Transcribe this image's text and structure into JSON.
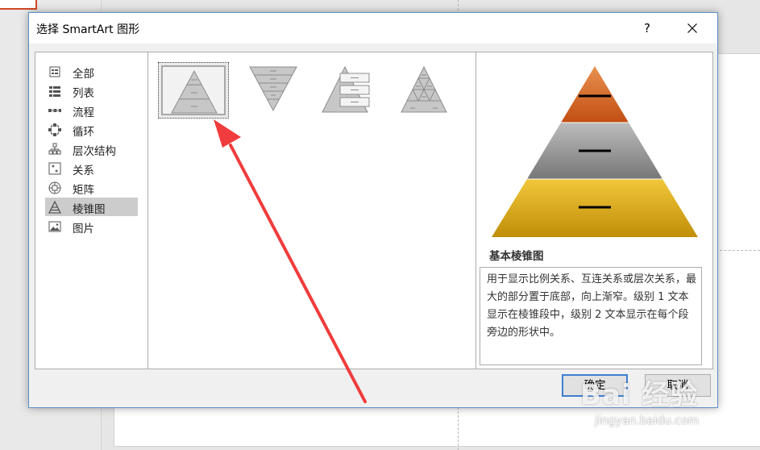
{
  "dialog": {
    "title": "选择 SmartArt 图形",
    "help_label": "?",
    "ok_label": "确定",
    "cancel_label": "取消"
  },
  "categories": [
    {
      "label": "全部",
      "icon": "all-icon"
    },
    {
      "label": "列表",
      "icon": "list-icon"
    },
    {
      "label": "流程",
      "icon": "process-icon"
    },
    {
      "label": "循环",
      "icon": "cycle-icon"
    },
    {
      "label": "层次结构",
      "icon": "hierarchy-icon"
    },
    {
      "label": "关系",
      "icon": "relationship-icon"
    },
    {
      "label": "矩阵",
      "icon": "matrix-icon"
    },
    {
      "label": "棱锥图",
      "icon": "pyramid-icon",
      "selected": true
    },
    {
      "label": "图片",
      "icon": "picture-icon"
    }
  ],
  "gallery": [
    {
      "icon": "basic-pyramid-icon",
      "selected": true
    },
    {
      "icon": "inverted-pyramid-icon"
    },
    {
      "icon": "pyramid-list-icon"
    },
    {
      "icon": "segmented-pyramid-icon"
    }
  ],
  "preview": {
    "name": "基本棱锥图",
    "description": "用于显示比例关系、互连关系或层次关系，最大的部分置于底部，向上渐窄。级别 1 文本显示在棱锥段中，级别 2 文本显示在每个段旁边的形状中。",
    "colors": {
      "top": "#d96b2b",
      "middle": "#8c8c8c",
      "bottom": "#d4a418"
    }
  },
  "watermark": {
    "logo": "Bai 经验",
    "url": "jingyan.baidu.com"
  },
  "colors": {
    "annotation_arrow": "#f03c3c",
    "dialog_border": "#5c8fc9",
    "default_button_border": "#3c7fd0"
  }
}
